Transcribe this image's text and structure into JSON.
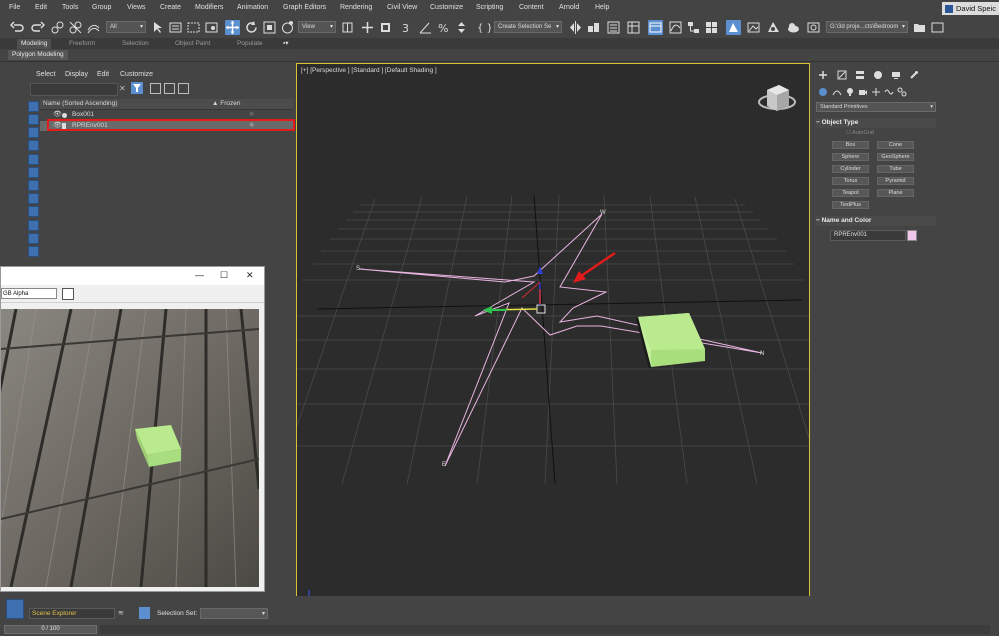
{
  "menu": [
    "File",
    "Edit",
    "Tools",
    "Group",
    "Views",
    "Create",
    "Modifiers",
    "Animation",
    "Graph Editors",
    "Rendering",
    "Civil View",
    "Customize",
    "Scripting",
    "Content",
    "Arnold",
    "Help"
  ],
  "user": "David Speic",
  "toolbar": {
    "selection_filter": "All",
    "reference_coord": "View",
    "named_selection": "Create Selection Se",
    "project_path": "G:\\3d proje...cts\\Bedroom"
  },
  "ribbon_tabs": [
    "Modeling",
    "Freeform",
    "Selection",
    "Object Paint",
    "Populate"
  ],
  "ribbon_active": "Modeling",
  "polygon_modeling": "Polygon Modeling",
  "explorer": {
    "menu": [
      "Select",
      "Display",
      "Edit",
      "Customize"
    ],
    "column_name": "Name (Sorted Ascending)",
    "column_frozen": "▲ Frozen",
    "rows": [
      {
        "name": "Box001"
      },
      {
        "name": "RPREnv001"
      }
    ]
  },
  "render_frame": {
    "channel": "GB Alpha",
    "minimize": "—",
    "maximize": "☐",
    "close": "✕"
  },
  "viewport": {
    "label": "[+] [Perspective ] [Standard ] [Default Shading ]",
    "compass_labels": {
      "w": "W",
      "s": "S",
      "n": "N",
      "e": "E"
    }
  },
  "command_panel": {
    "category": "Standard Primitives",
    "object_type_title": "Object Type",
    "autogrid": "AutoGrid",
    "buttons": [
      "Box",
      "Cone",
      "Sphere",
      "GeoSphere",
      "Cylinder",
      "Tube",
      "Torus",
      "Pyramid",
      "Teapot",
      "Plane",
      "TextPlus"
    ],
    "name_color_title": "Name and Color",
    "object_name": "RPREnv001",
    "object_color": "#f0c8ec"
  },
  "bottom": {
    "scene_explorer": "Scene Explorer",
    "selection_set_label": "Selection Set:",
    "time": "0 / 100"
  },
  "colors": {
    "accent": "#5c8fcf",
    "highlight_outline": "#e21b1b",
    "viewport_border": "#d9c23a",
    "box_green": "#b9ea8e",
    "compass_line": "#e8b4e0"
  }
}
